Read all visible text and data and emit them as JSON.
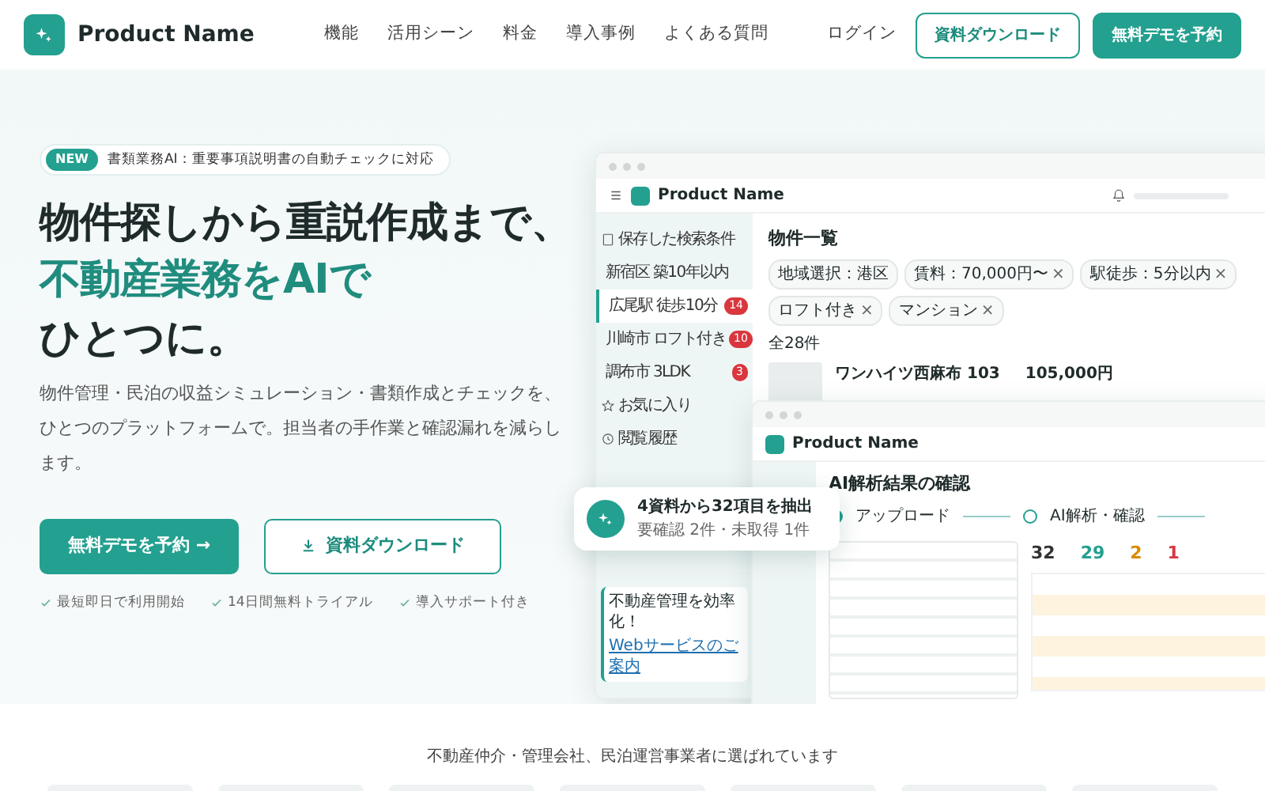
{
  "nav": {
    "brand": "Product Name",
    "links": [
      "機能",
      "活用シーン",
      "料金",
      "導入事例",
      "よくある質問"
    ],
    "login": "ログイン",
    "download": "資料ダウンロード",
    "demo": "無料デモを予約"
  },
  "hero": {
    "badge": "NEW",
    "announcement": "書類業務AI：重要事項説明書の自動チェックに対応",
    "headline": [
      {
        "text": "物件探しから重説作成まで、",
        "accent": false
      },
      {
        "text": "不動産業務をAIで",
        "accent": true
      },
      {
        "text": "ひとつに。",
        "accent": false
      }
    ],
    "lead": "物件管理・民泊の収益シミュレーション・書類作成とチェックを、ひとつのプラットフォームで。担当者の手作業と確認漏れを減らします。",
    "primary_button": "無料デモを予約",
    "primary_arrow": "→",
    "secondary_button": "資料ダウンロード",
    "features": [
      "最短即日で利用開始",
      "14日間無料トライアル",
      "導入サポート付き"
    ]
  },
  "list_window": {
    "brand": "Product Name",
    "sidebar": [
      {
        "label": "保存した検索条件",
        "kind": "group",
        "selected": false
      },
      {
        "label": "新宿区 築10年以内",
        "kind": "item",
        "selected": false
      },
      {
        "label": "広尾駅 徒歩10分",
        "kind": "item",
        "selected": true,
        "count": "14"
      },
      {
        "label": "川崎市 ロフト付き",
        "kind": "item",
        "selected": false,
        "count": "10"
      },
      {
        "label": "調布市 3LDK",
        "kind": "item",
        "selected": false,
        "count": "3"
      },
      {
        "label": "お気に入り",
        "kind": "star",
        "selected": false
      },
      {
        "label": "閲覧履歴",
        "kind": "history",
        "selected": false
      }
    ],
    "promo": {
      "title": "不動産管理を効率化！",
      "link": "Webサービスのご案内"
    },
    "title": "物件一覧",
    "area_select": "地域選択：港区",
    "chips": [
      {
        "label": "賃料：70,000円〜",
        "remove": "×"
      },
      {
        "label": "駅徒歩：5分以内",
        "remove": "×"
      },
      {
        "label": "ロフト付き",
        "remove": "×"
      },
      {
        "label": "マンション",
        "remove": "×"
      }
    ],
    "count": "全28件",
    "row": {
      "name": "ワンハイツ西麻布 103",
      "rent": "105,000円"
    }
  },
  "analysis_window": {
    "brand": "Product Name",
    "title": "AI解析結果の確認",
    "steps": [
      "アップロード",
      "AI解析・確認"
    ],
    "stats": [
      "32",
      "29",
      "2",
      "1"
    ]
  },
  "popover": {
    "title": "4資料から32項目を抽出",
    "detail": "要確認 2件・未取得 1件"
  },
  "clients": {
    "heading": "不動産仲介・管理会社、民泊運営事業者に選ばれています"
  }
}
